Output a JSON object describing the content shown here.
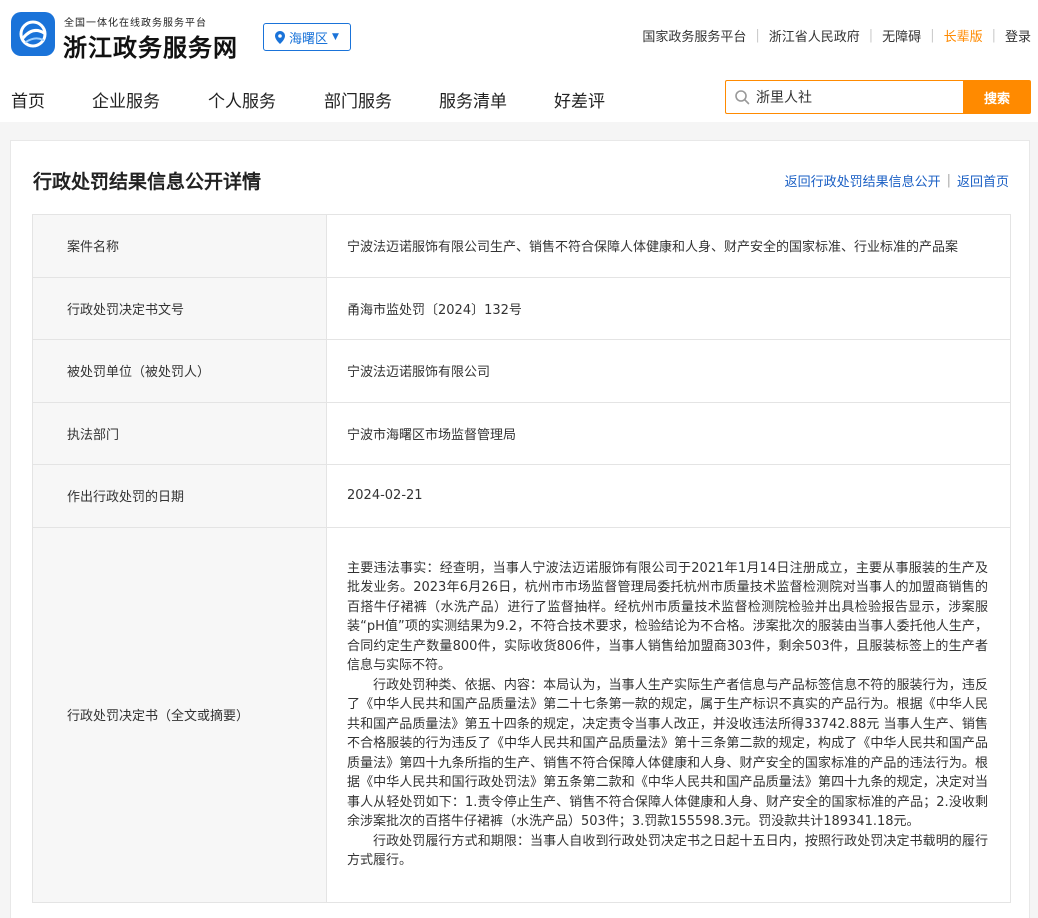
{
  "header": {
    "logo_subtitle": "全国一体化在线政务服务平台",
    "logo_title": "浙江政务服务网",
    "region": "海曙区",
    "top_links": [
      {
        "label": "国家政务服务平台",
        "highlight": false
      },
      {
        "label": "浙江省人民政府",
        "highlight": false
      },
      {
        "label": "无障碍",
        "highlight": false
      },
      {
        "label": "长辈版",
        "highlight": true
      },
      {
        "label": "登录",
        "highlight": false
      }
    ]
  },
  "nav": {
    "items": [
      "首页",
      "企业服务",
      "个人服务",
      "部门服务",
      "服务清单",
      "好差评"
    ]
  },
  "search": {
    "value": "浙里人社",
    "button": "搜索"
  },
  "page": {
    "title": "行政处罚结果信息公开详情",
    "link_back": "返回行政处罚结果信息公开",
    "link_home": "返回首页"
  },
  "rows": [
    {
      "label": "案件名称",
      "value": "宁波法迈诺服饰有限公司生产、销售不符合保障人体健康和人身、财产安全的国家标准、行业标准的产品案"
    },
    {
      "label": "行政处罚决定书文号",
      "value": "甬海市监处罚〔2024〕132号"
    },
    {
      "label": "被处罚单位（被处罚人）",
      "value": "宁波法迈诺服饰有限公司"
    },
    {
      "label": "执法部门",
      "value": "宁波市海曙区市场监督管理局"
    },
    {
      "label": "作出行政处罚的日期",
      "value": "2024-02-21"
    }
  ],
  "decision": {
    "label": "行政处罚决定书（全文或摘要）",
    "paragraphs": [
      "主要违法事实：经查明，当事人宁波法迈诺服饰有限公司于2021年1月14日注册成立，主要从事服装的生产及批发业务。2023年6月26日，杭州市市场监督管理局委托杭州市质量技术监督检测院对当事人的加盟商销售的百搭牛仔裙裤（水洗产品）进行了监督抽样。经杭州市质量技术监督检测院检验并出具检验报告显示，涉案服装“pH值”项的实测结果为9.2，不符合技术要求，检验结论为不合格。涉案批次的服装由当事人委托他人生产，合同约定生产数量800件，实际收货806件，当事人销售给加盟商303件，剩余503件，且服装标签上的生产者信息与实际不符。",
      "行政处罚种类、依据、内容：本局认为，当事人生产实际生产者信息与产品标签信息不符的服装行为，违反了《中华人民共和国产品质量法》第二十七条第一款的规定，属于生产标识不真实的产品行为。根据《中华人民共和国产品质量法》第五十四条的规定，决定责令当事人改正，并没收违法所得33742.88元 当事人生产、销售不合格服装的行为违反了《中华人民共和国产品质量法》第十三条第二款的规定，构成了《中华人民共和国产品质量法》第四十九条所指的生产、销售不符合保障人体健康和人身、财产安全的国家标准的产品的违法行为。根据《中华人民共和国行政处罚法》第五条第二款和《中华人民共和国产品质量法》第四十九条的规定，决定对当事人从轻处罚如下：1.责令停止生产、销售不符合保障人体健康和人身、财产安全的国家标准的产品；2.没收剩余涉案批次的百搭牛仔裙裤（水洗产品）503件；3.罚款155598.3元。罚没款共计189341.18元。",
      "行政处罚履行方式和期限：当事人自收到行政处罚决定书之日起十五日内，按照行政处罚决定书载明的履行方式履行。"
    ]
  },
  "colors": {
    "brand_blue": "#1a73d9",
    "accent_orange": "#ff8a00",
    "link_blue": "#1a5fc4"
  }
}
